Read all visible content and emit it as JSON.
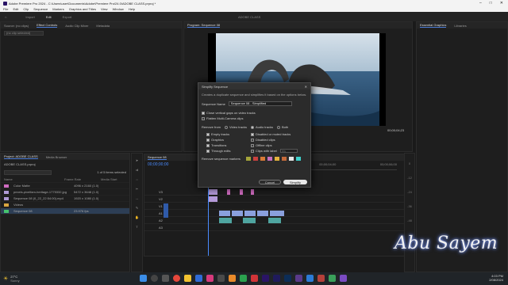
{
  "window": {
    "title": "Adobe Premiere Pro 2024 - C:\\Users\\user\\Documents\\Adobe\\Premiere Pro\\24.0\\ADOBE CLASS.prproj *"
  },
  "menu": [
    "File",
    "Edit",
    "Clip",
    "Sequence",
    "Markers",
    "Graphics and Titles",
    "View",
    "Window",
    "Help"
  ],
  "header": {
    "tabs": [
      "Import",
      "Edit",
      "Export"
    ],
    "center": "ADOBE CLASS"
  },
  "source_panel": {
    "tabs": [
      "Source: (no clips)",
      "Effect Controls",
      "Audio Clip Mixer",
      "Metadata"
    ],
    "field": "(no clip selected)"
  },
  "program": {
    "title": "Program: Sequence 08",
    "timecode_left": "00;00;00;00",
    "timecode_right": "00;00;04;23",
    "fit": "Fit",
    "res": "Full"
  },
  "right_panel": {
    "tabs": [
      "Essential Graphics",
      "Libraries"
    ]
  },
  "project": {
    "tabs": [
      "Project: ADOBE CLASS",
      "Media Browser"
    ],
    "file": "ADOBE CLASS.prproj",
    "count": "1 of 5 items selected",
    "columns": [
      "Name",
      "Frame Rate",
      "Media Start"
    ],
    "rows": [
      {
        "name": "Color Matte",
        "info": "4096 x 2160 (1.0)",
        "color": "#d06cc1"
      },
      {
        "name": "pexels-pixelfam-heritage-1775332.jpg",
        "info": "5472 x 3648 (1.0)",
        "color": "#b09ad6"
      },
      {
        "name": "Sequence 08 (0_22_22:54:00).mp4",
        "info": "1920 x 1080 (1.0)",
        "color": "#b09ad6"
      },
      {
        "name": "Videos",
        "info": "",
        "color": "#d9a640"
      },
      {
        "name": "Sequence 08",
        "info": "23.976 fps",
        "color": "#46c46e"
      }
    ]
  },
  "timeline": {
    "tab": "Sequence 08",
    "timecode": "00;00;00;00",
    "ruler": [
      "00;00",
      "00;00;02;00",
      "00;00;04;00",
      "00;00;06;00"
    ],
    "tracks": [
      "V3",
      "V2",
      "V1",
      "A1",
      "A2",
      "A3"
    ]
  },
  "dialog": {
    "title": "Simplify Sequence",
    "desc": "Creates a duplicate sequence and simplifies it based on the options below.",
    "name_label": "Sequence Name",
    "name_value": "Sequence 08 - Simplified",
    "opt_gaps": "Close vertical gaps on video tracks",
    "opt_multicam": "Flatten Multi-Camera clips",
    "remove_from": "Remove from",
    "radios": [
      "Video tracks",
      "Audio tracks",
      "Both"
    ],
    "left_opts": [
      "Empty tracks",
      "Graphics",
      "Transitions",
      "Through edits"
    ],
    "right_opts": [
      "Disabled or muted tracks",
      "Disabled clips",
      "Offline clips",
      "Clips with label"
    ],
    "label_field": "Iris",
    "markers_label": "Remove sequence markers",
    "marker_colors": [
      "#a4a43a",
      "#c9413f",
      "#d77a37",
      "#c66fbd",
      "#e2b23d",
      "#c46a3a",
      "#e6e6e6",
      "#3ed1cc"
    ],
    "cancel": "Cancel",
    "ok": "Simplify"
  },
  "watermark": "Abu Sayem",
  "taskbar": {
    "weather_temp": "27°C",
    "weather_desc": "Sunny",
    "time": "4:03 PM",
    "date": "2/08/2024"
  }
}
